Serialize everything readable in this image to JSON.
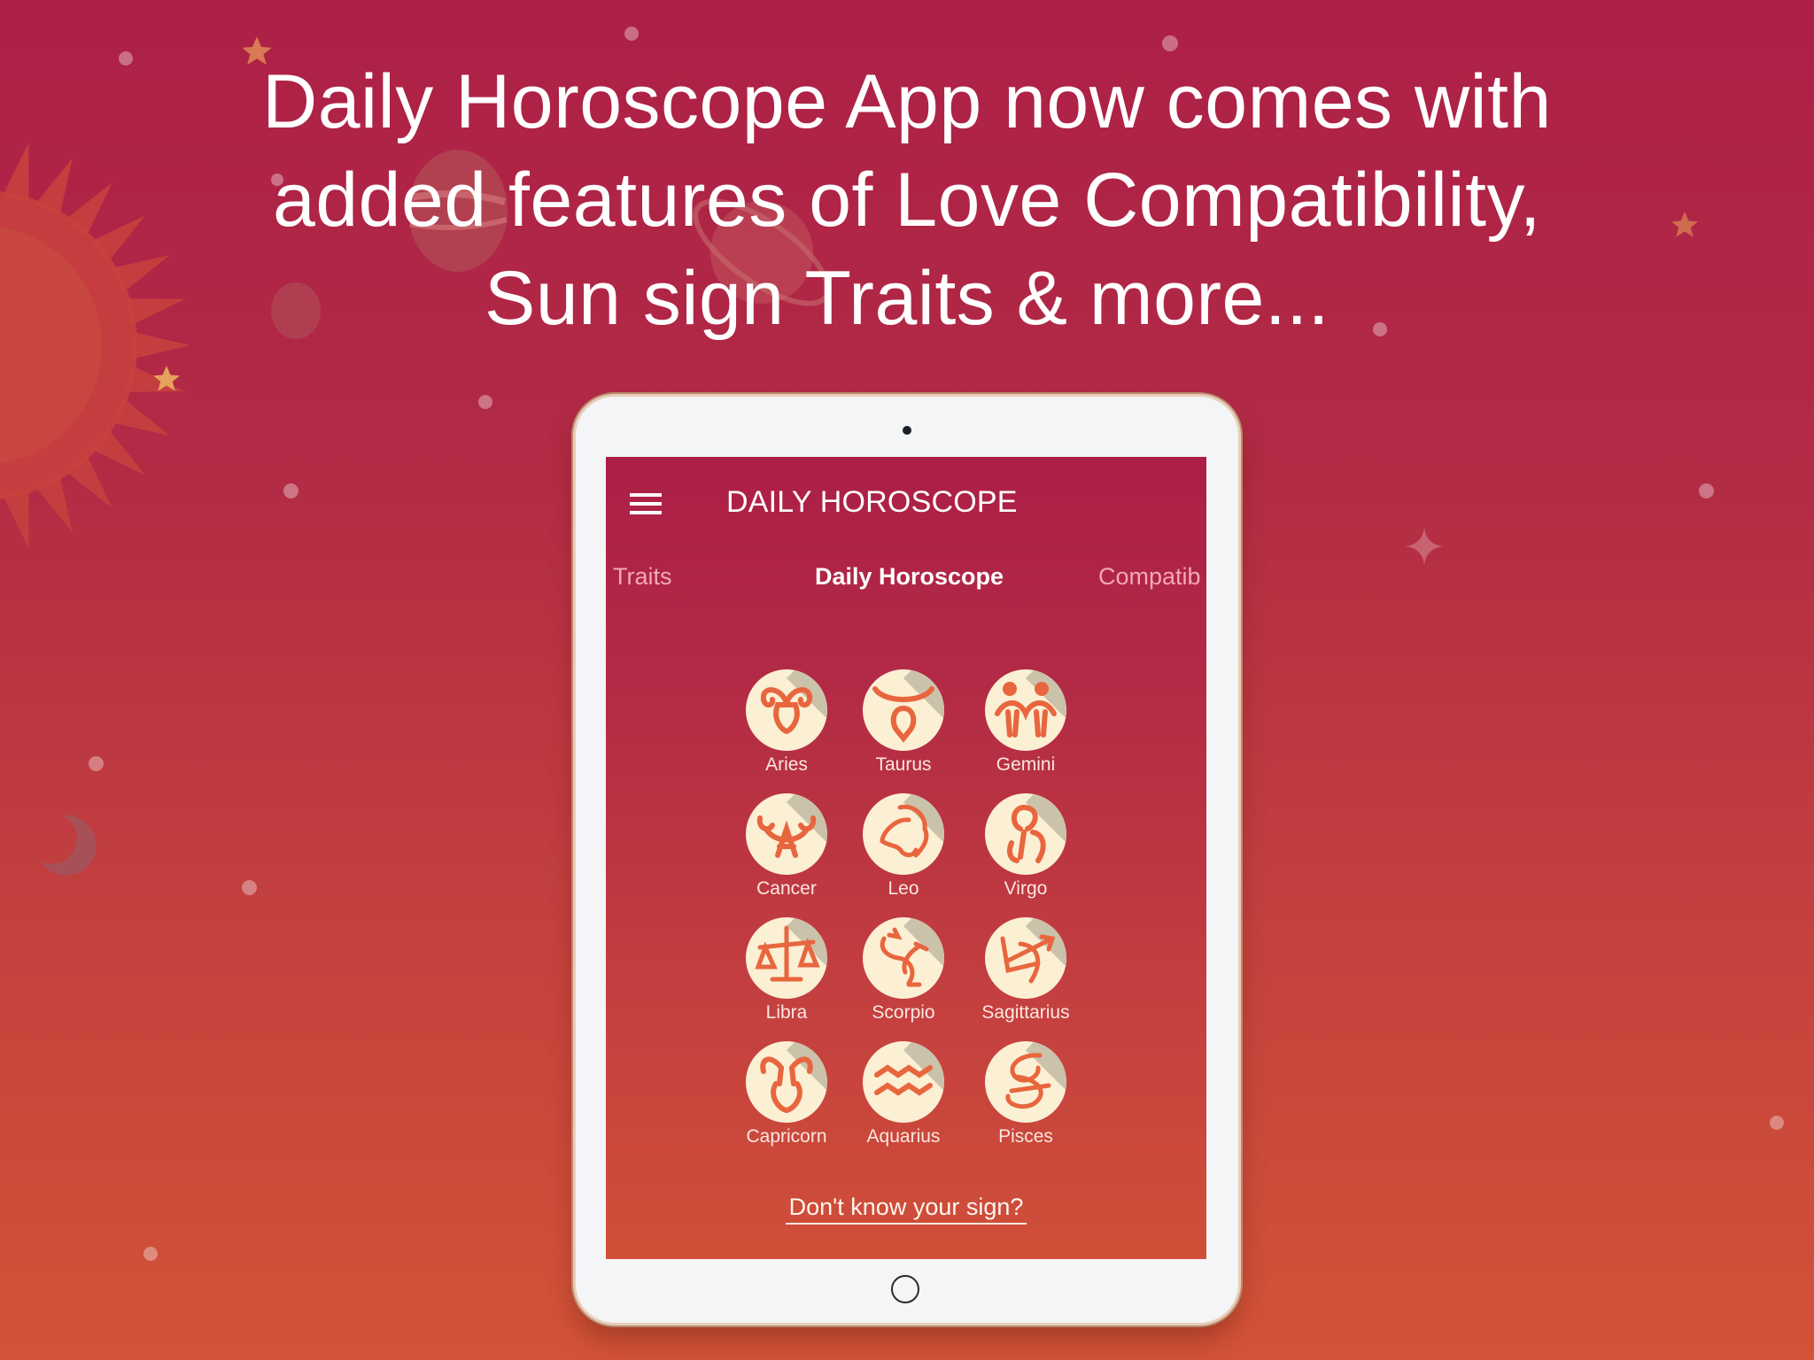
{
  "headline": {
    "lines": [
      "Daily Horoscope App now comes with",
      "added features of Love Compatibility,",
      "Sun sign Traits & more..."
    ]
  },
  "app": {
    "menu_icon": "hamburger-menu-icon",
    "title": "DAILY HOROSCOPE",
    "tabs": [
      {
        "label": "Traits",
        "active": false
      },
      {
        "label": "Daily Horoscope",
        "active": true
      },
      {
        "label": "Compatib",
        "active": false
      }
    ],
    "signs": [
      {
        "name": "Aries",
        "icon": "aries-icon"
      },
      {
        "name": "Taurus",
        "icon": "taurus-icon"
      },
      {
        "name": "Gemini",
        "icon": "gemini-icon"
      },
      {
        "name": "Cancer",
        "icon": "cancer-icon"
      },
      {
        "name": "Leo",
        "icon": "leo-icon"
      },
      {
        "name": "Virgo",
        "icon": "virgo-icon"
      },
      {
        "name": "Libra",
        "icon": "libra-icon"
      },
      {
        "name": "Scorpio",
        "icon": "scorpio-icon"
      },
      {
        "name": "Sagittarius",
        "icon": "sagittarius-icon"
      },
      {
        "name": "Capricorn",
        "icon": "capricorn-icon"
      },
      {
        "name": "Aquarius",
        "icon": "aquarius-icon"
      },
      {
        "name": "Pisces",
        "icon": "pisces-icon"
      }
    ],
    "unknown_sign_link": "Don't know your sign?"
  },
  "colors": {
    "background_top": "#ad2047",
    "background_bottom": "#d25337",
    "icon_fill": "#fbefd4",
    "icon_glyph": "#e8663e",
    "tab_inactive": "#f3a8b4"
  }
}
